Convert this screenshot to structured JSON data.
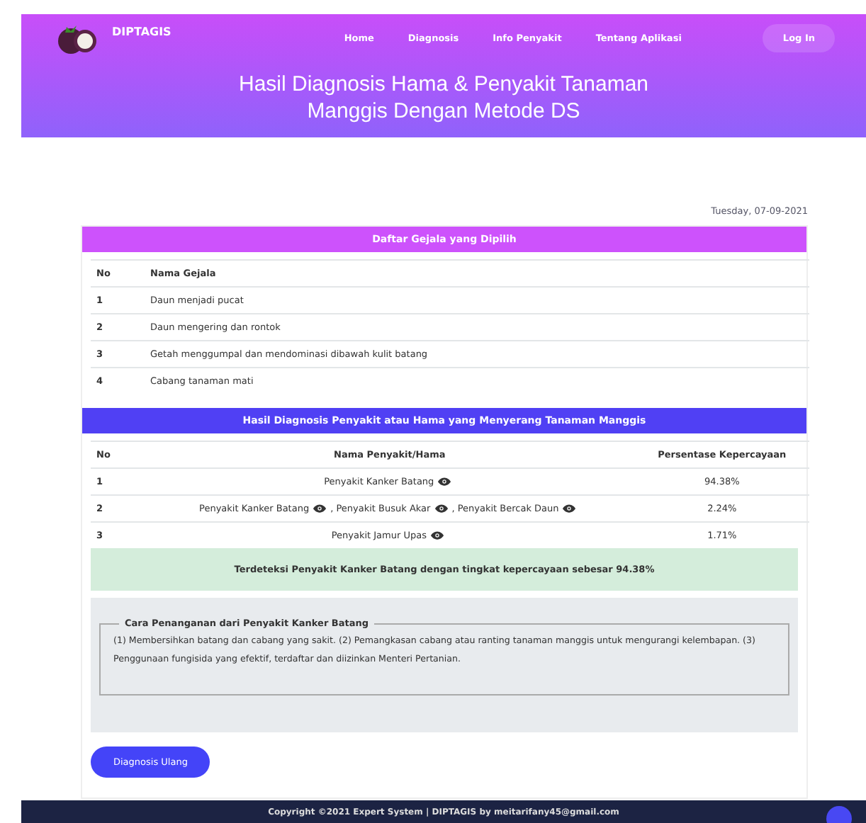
{
  "brand": "DIPTAGIS",
  "nav": [
    {
      "label": "Home"
    },
    {
      "label": "Diagnosis"
    },
    {
      "label": "Info Penyakit"
    },
    {
      "label": "Tentang Aplikasi"
    }
  ],
  "login": "Log In",
  "title": "Hasil Diagnosis Hama & Penyakit Tanaman Manggis Dengan Metode DS",
  "date": "Tuesday, 07-09-2021",
  "symptoms": {
    "heading": "Daftar Gejala yang Dipilih",
    "columns": [
      "No",
      "Nama Gejala"
    ],
    "rows": [
      {
        "no": "1",
        "name": "Daun menjadi pucat"
      },
      {
        "no": "2",
        "name": "Daun mengering dan rontok"
      },
      {
        "no": "3",
        "name": "Getah menggumpal dan mendominasi dibawah kulit batang"
      },
      {
        "no": "4",
        "name": "Cabang tanaman mati"
      }
    ]
  },
  "results": {
    "heading": "Hasil Diagnosis Penyakit atau Hama yang Menyerang Tanaman Manggis",
    "columns": [
      "No",
      "Nama Penyakit/Hama",
      "Persentase Kepercayaan"
    ],
    "rows": [
      {
        "no": "1",
        "diseases": [
          "Penyakit Kanker Batang"
        ],
        "percent": "94.38%"
      },
      {
        "no": "2",
        "diseases": [
          "Penyakit Kanker Batang",
          ", Penyakit Busuk Akar",
          ", Penyakit Bercak Daun"
        ],
        "percent": "2.24%"
      },
      {
        "no": "3",
        "diseases": [
          "Penyakit Jamur Upas"
        ],
        "percent": "1.71%"
      }
    ]
  },
  "conclusion": "Terdeteksi Penyakit Kanker Batang dengan tingkat kepercayaan sebesar 94.38%",
  "treatment": {
    "legend": "Cara Penanganan dari Penyakit Kanker Batang",
    "text": "(1) Membersihkan batang dan cabang yang sakit. (2) Pemangkasan cabang atau ranting tanaman manggis untuk mengurangi kelembapan. (3) Penggunaan fungisida yang efektif, terdaftar dan diizinkan Menteri Pertanian."
  },
  "retry_button": "Diagnosis Ulang",
  "footer": "Copyright ©2021 Expert System | DIPTAGIS by meitarifany45@gmail.com"
}
